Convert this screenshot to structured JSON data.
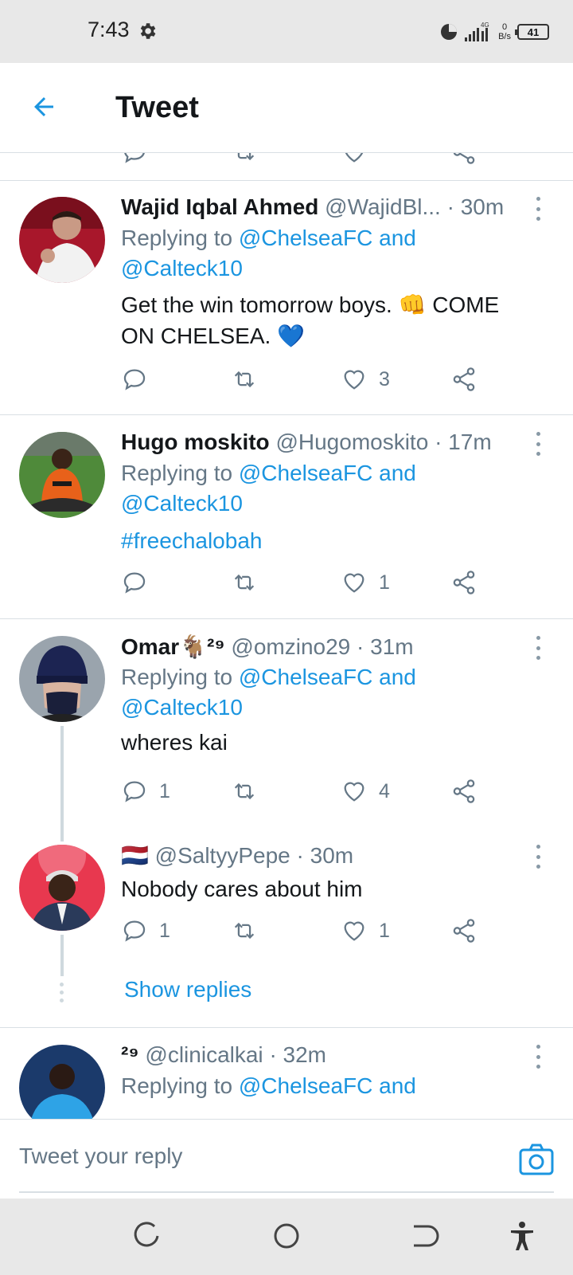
{
  "status_bar": {
    "time": "7:43",
    "network": "4G",
    "speed_value": "0",
    "speed_unit": "B/s",
    "battery": "41"
  },
  "header": {
    "title": "Tweet"
  },
  "tweets": [
    {
      "name": "Wajid Iqbal Ahmed",
      "handle": "@WajidBl...",
      "time": "· 30m",
      "replying_prefix": "Replying to ",
      "replying_1": "@ChelseaFC and",
      "replying_2": "@Calteck10",
      "text_1": "Get the win tomorrow boys. 👊 COME",
      "text_2": "ON CHELSEA. 💙",
      "replies": "",
      "likes": "3"
    },
    {
      "name": "Hugo moskito",
      "handle": "@Hugomoskito",
      "time": "· 17m",
      "replying_prefix": "Replying to ",
      "replying_1": "@ChelseaFC and",
      "replying_2": "@Calteck10",
      "text_1": "#freechalobah",
      "replies": "",
      "likes": "1"
    },
    {
      "name": "Omar🐐²⁹",
      "handle": "@omzino29",
      "time": "· 31m",
      "replying_prefix": "Replying to ",
      "replying_1": "@ChelseaFC and",
      "replying_2": "@Calteck10",
      "text_1": "wheres kai",
      "replies": "1",
      "likes": "4"
    },
    {
      "name": "🇳🇱",
      "handle": "@SaltyyPepe",
      "time": "· 30m",
      "text_1": "Nobody cares about him",
      "replies": "1",
      "likes": "1",
      "show_replies": "Show replies"
    },
    {
      "name": "²⁹",
      "handle": "@clinicalkai",
      "time": "· 32m",
      "replying_prefix": "Replying to ",
      "replying_1": "@ChelseaFC and"
    }
  ],
  "reply_bar": {
    "placeholder": "Tweet your reply"
  },
  "icons": {
    "accent": "#1b95e0",
    "muted": "#657786"
  }
}
